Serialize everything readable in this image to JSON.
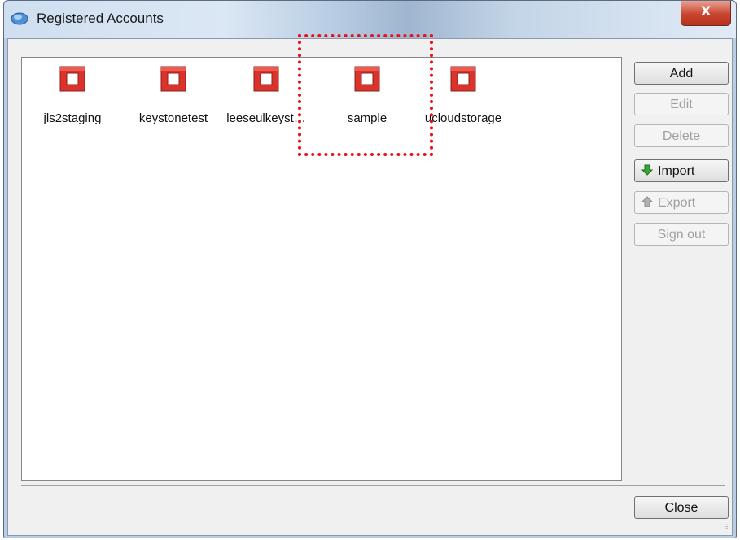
{
  "window": {
    "title": "Registered Accounts",
    "close_glyph": "X"
  },
  "accounts": [
    {
      "label": "jls2staging",
      "icon": "openstack-icon"
    },
    {
      "label": "keystonetest",
      "icon": "openstack-icon"
    },
    {
      "label": "leeseulkeyst…",
      "icon": "openstack-icon"
    },
    {
      "label": "sample",
      "icon": "openstack-icon"
    },
    {
      "label": "ucloudstorage",
      "icon": "openstack-icon"
    }
  ],
  "buttons": {
    "add": "Add",
    "edit": "Edit",
    "delete": "Delete",
    "import": "Import",
    "export": "Export",
    "sign_out": "Sign out",
    "close": "Close"
  },
  "colors": {
    "highlight": "#e8121b",
    "icon_red": "#d9332b",
    "import_arrow": "#3aa53a"
  }
}
